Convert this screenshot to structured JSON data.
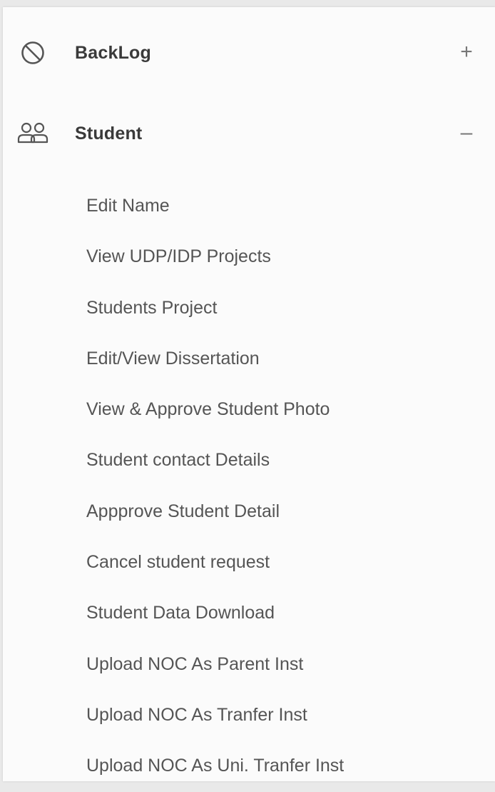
{
  "menu": {
    "backlog": {
      "label": "BackLog",
      "icon": "ban-icon",
      "toggle": "+"
    },
    "student": {
      "label": "Student",
      "icon": "users-icon",
      "toggle": "–",
      "items": [
        "Edit Name",
        "View UDP/IDP Projects",
        "Students Project",
        "Edit/View Dissertation",
        "View & Approve Student Photo",
        "Student contact Details",
        "Appprove Student Detail",
        "Cancel student request",
        "Student Data Download",
        "Upload NOC As Parent Inst",
        "Upload NOC As Tranfer Inst",
        "Upload NOC As Uni. Tranfer Inst"
      ]
    }
  },
  "colors": {
    "panel_background": "#fbfbfb",
    "group_text": "#3a3a3a",
    "item_text": "#555555",
    "icon_stroke": "#555555"
  }
}
